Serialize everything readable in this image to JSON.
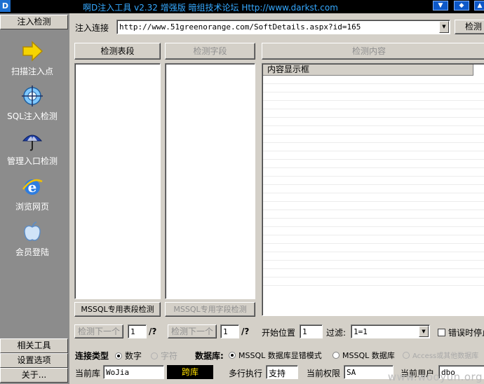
{
  "titlebar": {
    "app_icon": "D",
    "title": "啊D注入工具 v2.32 增强版 暗组技术论坛 Http://www.darkst.com",
    "buttons": [
      "▼",
      "◆",
      "▲"
    ]
  },
  "sidebar": {
    "top_header": "注入检测",
    "items": [
      {
        "label": "扫描注入点",
        "icon": "arrow-right-icon"
      },
      {
        "label": "SQL注入检测",
        "icon": "target-globe-icon"
      },
      {
        "label": "管理入口检测",
        "icon": "umbrella-icon"
      },
      {
        "label": "浏览网页",
        "icon": "ie-browser-icon"
      },
      {
        "label": "会员登陆",
        "icon": "apple-icon"
      }
    ],
    "bottom_headers": [
      "相关工具",
      "设置选项",
      "关于..."
    ]
  },
  "url_bar": {
    "label": "注入连接",
    "value": "http://www.51greenorange.com/SoftDetails.aspx?id=165",
    "detect_button": "检测"
  },
  "panels": {
    "tables_button": "检测表段",
    "fields_button": "检测字段",
    "content_button": "检测内容",
    "content_header": "内容显示框",
    "mssql_tables_button": "MSSQL专用表段检测",
    "mssql_fields_button": "MSSQL专用字段检测"
  },
  "paging": {
    "next_label": "检测下一个",
    "tables_page": "1",
    "fields_page": "1",
    "slash_q": "/?",
    "start_label": "开始位置",
    "start_value": "1",
    "filter_label": "过滤:",
    "filter_value": "1=1",
    "error_stop_label": "错误时停止"
  },
  "connection": {
    "type_label": "连接类型",
    "type_options": [
      "数字",
      "字符"
    ],
    "db_label": "数据库:",
    "db_options": [
      "MSSQL 数据库显错模式",
      "MSSQL 数据库",
      "Access或其他数据库"
    ]
  },
  "status": {
    "current_db_label": "当前库",
    "current_db_value": "WoJia",
    "cross_db_button": "跨库",
    "multi_exec_label": "多行执行",
    "multi_exec_value": "支持",
    "privilege_label": "当前权限",
    "privilege_value": "SA",
    "user_label": "当前用户",
    "user_value": "dbo"
  },
  "watermark": "www.wooyun.org"
}
